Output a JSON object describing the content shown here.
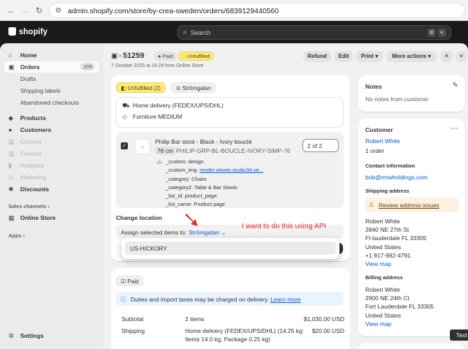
{
  "browser": {
    "url": "admin.shopify.com/store/by-crea-sweden/orders/6839129440560"
  },
  "topbar": {
    "logo": "shopify",
    "search_placeholder": "Search",
    "kbd1": "⌘",
    "kbd2": "K"
  },
  "sidebar": {
    "home": "Home",
    "orders": "Orders",
    "orders_count": "209",
    "drafts": "Drafts",
    "shipping_labels": "Shipping labels",
    "abandoned": "Abandoned checkouts",
    "products": "Products",
    "customers": "Customers",
    "content": "Content",
    "finance": "Finance",
    "analytics": "Analytics",
    "marketing": "Marketing",
    "discounts": "Discounts",
    "sales_channels": "Sales channels",
    "online_store": "Online Store",
    "apps": "Apps",
    "settings": "Settings"
  },
  "header": {
    "order_number": "51259",
    "paid": "Paid",
    "unfulfilled": "Unfulfilled",
    "date": "7 October 2025 at 19.29 from Online Store",
    "refund": "Refund",
    "edit": "Edit",
    "print": "Print",
    "more": "More actions"
  },
  "fulfillment": {
    "status": "Unfulfilled (2)",
    "location": "Strömgatan",
    "delivery": "Home delivery (FEDEX/UPS/DHL)",
    "tag": "Furniture MEDIUM",
    "item_title": "Philip Bar stool - Black - Ivory bouclé",
    "item_size": "76 cm",
    "item_sku": "PHILIP-GRP-BL-BOUCLE-IVORY-SIMP-76",
    "qty": "2 of 2",
    "props": [
      {
        "k": "_custom:",
        "v": "design",
        "link": false
      },
      {
        "k": "_custom_img:",
        "v": "render.viewer.studio3d.se...",
        "link": true
      },
      {
        "k": "_category:",
        "v": "Chairs",
        "link": false
      },
      {
        "k": "_category2:",
        "v": "Table & Bar Stools",
        "link": false
      },
      {
        "k": "_list_id:",
        "v": "product_page",
        "link": false
      },
      {
        "k": "_list_name:",
        "v": "Product page",
        "link": false
      }
    ],
    "change_location": "Change location",
    "assign_label": "Assign selected items to:",
    "assign_value": "Strömgatan",
    "dropdown_option": "US-HICKORY"
  },
  "annotation": "I want to do this using API",
  "payment": {
    "status": "Paid",
    "notice": "Duties and import taxes may be charged on delivery.",
    "learn_more": "Learn more",
    "subtotal_label": "Subtotal",
    "subtotal_items": "2 items",
    "subtotal_amount": "$1,030.00 USD",
    "shipping_label": "Shipping",
    "shipping_desc": "Home delivery (FEDEX/UPS/DHL) (14.25 kg:",
    "shipping_desc2": "Items 14.0 kg, Package 0.25 kg)",
    "shipping_amount": "$20.00 USD"
  },
  "notes": {
    "title": "Notes",
    "empty": "No notes from customer"
  },
  "customer": {
    "title": "Customer",
    "name": "Robert White",
    "orders": "1 order",
    "contact_title": "Contact information",
    "email": "bob@rmwholdings.com",
    "shipping_title": "Shipping address",
    "review": "Review address issues",
    "ship_lines": [
      "Robert White",
      "2840 NE 27th St",
      "Ft lauderdale FL 33305",
      "United States",
      "+1 917-992-4791"
    ],
    "view_map": "View map",
    "billing_title": "Billing address",
    "bill_lines": [
      "Robert White",
      "2900 NE 24th Ct",
      "Fort Lauderdale FL 33305",
      "United States"
    ]
  },
  "tooltip": "Text"
}
